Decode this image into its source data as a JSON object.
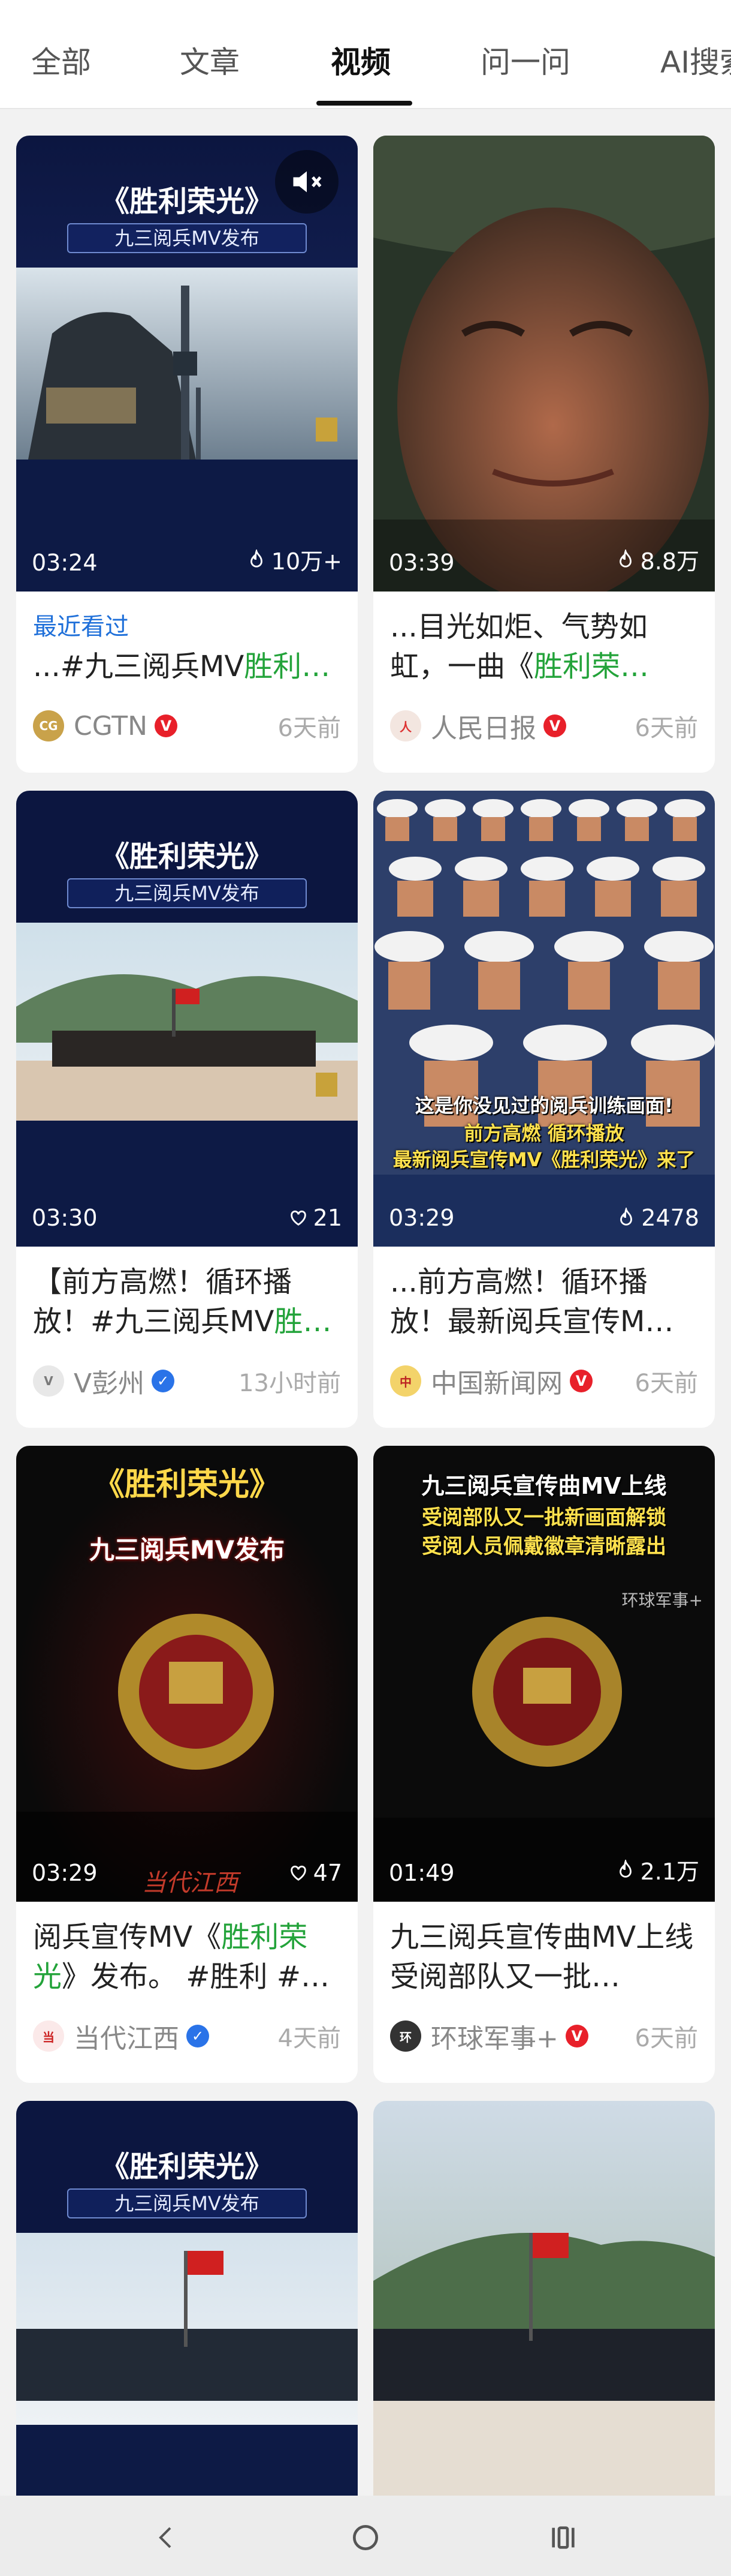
{
  "tabs": [
    {
      "label": "全部",
      "active": false
    },
    {
      "label": "文章",
      "active": false
    },
    {
      "label": "视频",
      "active": true
    },
    {
      "label": "问一问",
      "active": false
    },
    {
      "label": "AI搜索",
      "active": false
    }
  ],
  "cards": [
    {
      "duration": "03:24",
      "plays": "10万+",
      "plays_icon": "flame-icon",
      "recent_label": "最近看过",
      "title_pre": "...#九三阅兵MV",
      "title_hl": "胜利…",
      "title_post": "",
      "author": "CGTN",
      "verified": "red",
      "time": "6天前",
      "thumb_title": "《胜利荣光》",
      "thumb_sub": "九三阅兵MV发布"
    },
    {
      "duration": "03:39",
      "plays": "8.8万",
      "plays_icon": "flame-icon",
      "title_pre": "...目光如炬、气势如虹，一曲《",
      "title_hl": "胜利荣…",
      "title_post": "",
      "author": "人民日报",
      "verified": "red",
      "time": "6天前"
    },
    {
      "duration": "03:30",
      "plays": "21",
      "plays_icon": "heart-icon",
      "title_pre": "【前方高燃！循环播放！#九三阅兵MV",
      "title_hl": "胜…",
      "title_post": "",
      "author": "V彭州",
      "verified": "blue",
      "time": "13小时前",
      "thumb_title": "《胜利荣光》",
      "thumb_sub": "九三阅兵MV发布"
    },
    {
      "duration": "03:29",
      "plays": "2478",
      "plays_icon": "flame-icon",
      "title_pre": "...前方高燃！循环播放！最新阅兵宣传M…",
      "title_hl": "",
      "title_post": "",
      "author": "中国新闻网",
      "verified": "red",
      "time": "6天前",
      "caption1": "这是你没见过的阅兵训练画面!",
      "caption2": "前方高燃 循环播放",
      "caption3": "最新阅兵宣传MV《胜利荣光》来了"
    },
    {
      "duration": "03:29",
      "plays": "47",
      "plays_icon": "heart-icon",
      "title_pre": "阅兵宣传MV《",
      "title_hl": "胜利荣光",
      "title_post": "》发布。 #胜利 #…",
      "author": "当代江西",
      "verified": "blue",
      "time": "4天前",
      "thumb_title": "《胜利荣光》",
      "thumb_sub": "九三阅兵MV发布",
      "watermark": "当代江西"
    },
    {
      "duration": "01:49",
      "plays": "2.1万",
      "plays_icon": "flame-icon",
      "title_pre": "九三阅兵宣传曲MV上线 受阅部队又一批…",
      "title_hl": "",
      "title_post": "",
      "author": "环球军事+",
      "verified": "red",
      "time": "6天前",
      "caption1": "九三阅兵宣传曲MV上线",
      "caption2": "受阅部队又一批新画面解锁",
      "caption3": "受阅人员佩戴徽章清晰露出",
      "watermark": "环球军事+"
    },
    {
      "thumb_title": "《胜利荣光》",
      "thumb_sub": "九三阅兵MV发布"
    },
    {}
  ],
  "colors": {
    "highlight": "#23a33a",
    "recent": "#1e6fd9",
    "verified_red": "#e8202a",
    "verified_blue": "#2a73e8"
  },
  "sysnav": {
    "back_icon": "back-icon",
    "home_icon": "home-icon",
    "recents_icon": "recents-icon"
  }
}
